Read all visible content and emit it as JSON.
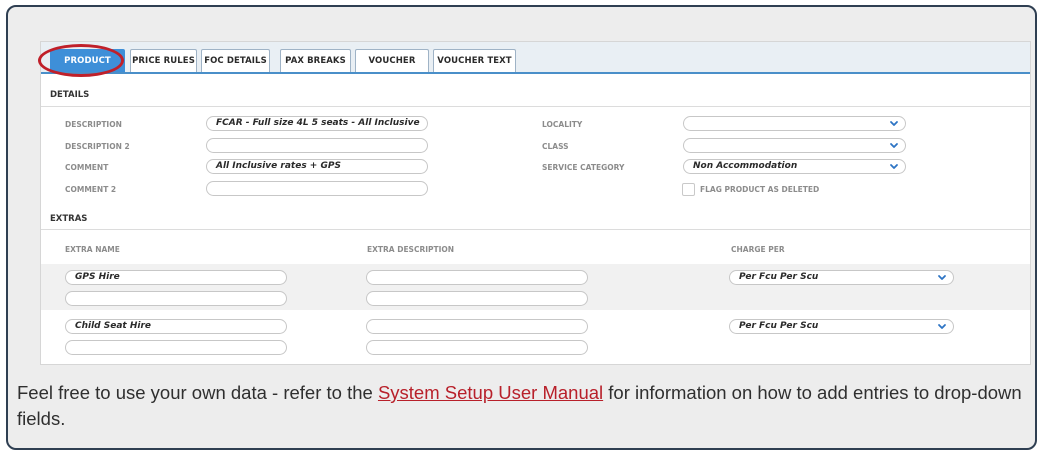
{
  "tabs": [
    {
      "label": "PRODUCT",
      "active": true
    },
    {
      "label": "PRICE RULES"
    },
    {
      "label": "FOC DETAILS"
    },
    {
      "label": "PAX BREAKS"
    },
    {
      "label": "VOUCHER"
    },
    {
      "label": "VOUCHER TEXT"
    }
  ],
  "details": {
    "heading": "DETAILS",
    "description_label": "DESCRIPTION",
    "description_value": "FCAR - Full size 4L 5 seats - All Inclusive",
    "description2_label": "DESCRIPTION 2",
    "description2_value": "",
    "comment_label": "COMMENT",
    "comment_value": "All Inclusive rates + GPS",
    "comment2_label": "COMMENT 2",
    "comment2_value": "",
    "locality_label": "LOCALITY",
    "locality_value": "",
    "class_label": "CLASS",
    "class_value": "",
    "service_category_label": "SERVICE CATEGORY",
    "service_category_value": "Non Accommodation",
    "flag_deleted_label": "FLAG PRODUCT AS DELETED",
    "flag_deleted_checked": false
  },
  "extras": {
    "heading": "EXTRAS",
    "col_name": "EXTRA NAME",
    "col_description": "EXTRA DESCRIPTION",
    "col_charge": "CHARGE PER",
    "rows": [
      {
        "name": "GPS Hire",
        "name2": "",
        "description": "",
        "description2": "",
        "charge_per": "Per Fcu Per Scu"
      },
      {
        "name": "Child Seat Hire",
        "name2": "",
        "description": "",
        "description2": "",
        "charge_per": "Per Fcu Per Scu"
      }
    ]
  },
  "note": {
    "text_before": "Feel free to use your own data - refer to the ",
    "link_text": "System Setup User Manual",
    "text_after": " for information on how to add entries to drop-down fields."
  },
  "colors": {
    "active_tab": "#3e8fd8",
    "highlight_ring": "#c0202a",
    "link": "#b8202a",
    "chevron": "#2d74c4"
  },
  "icons": {
    "dropdown": "chevron-down-icon"
  }
}
